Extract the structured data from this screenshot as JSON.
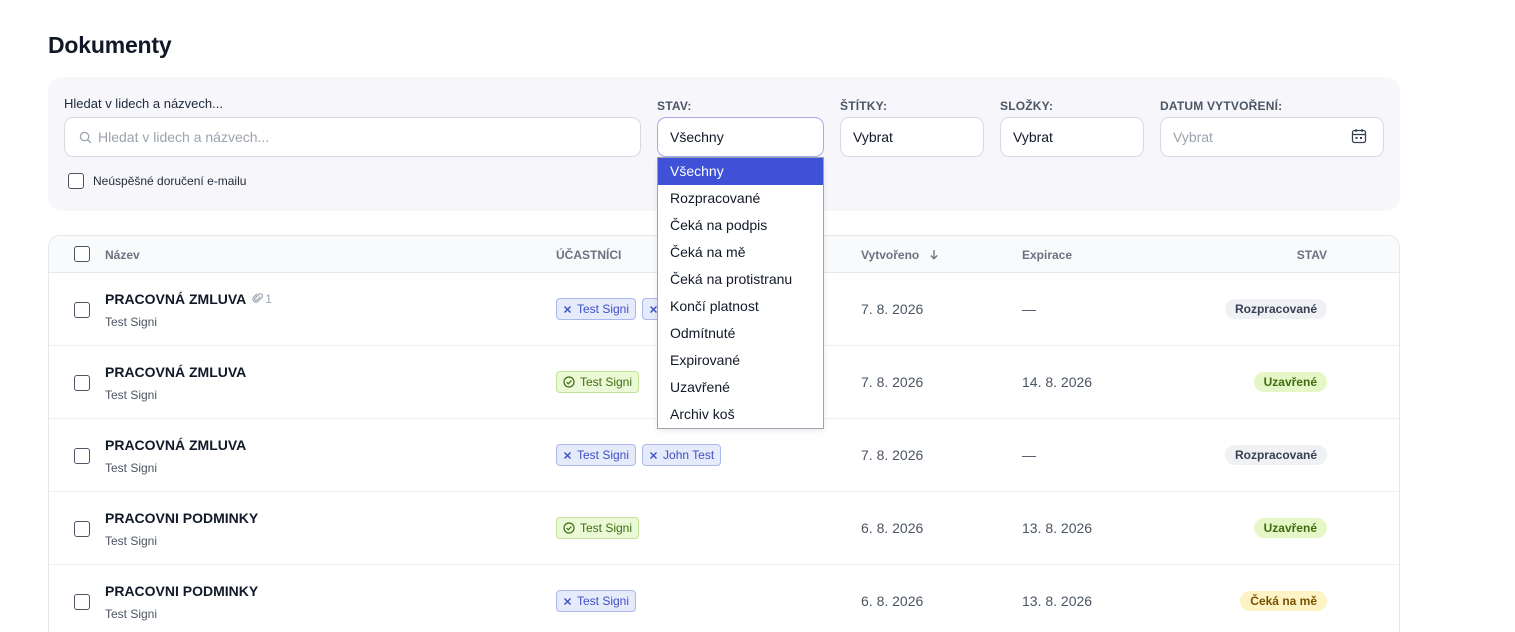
{
  "page": {
    "title": "Dokumenty"
  },
  "filters": {
    "search_label": "Hledat v lidech a názvech...",
    "search_placeholder": "Hledat v lidech a názvech...",
    "stav_label": "STAV:",
    "stav_value": "Všechny",
    "stitky_label": "ŠTÍTKY:",
    "stitky_value": "Vybrat",
    "slozky_label": "SLOŽKY:",
    "slozky_value": "Vybrat",
    "datum_label": "DATUM VYTVOŘENÍ:",
    "datum_placeholder": "Vybrat",
    "email_failed_label": "Neúspěšné doručení e-mailu"
  },
  "stav_dropdown": {
    "options": [
      "Všechny",
      "Rozpracované",
      "Čeká na podpis",
      "Čeká na mě",
      "Čeká na protistranu",
      "Končí platnost",
      "Odmítnuté",
      "Expirované",
      "Uzavřené",
      "Archiv koš"
    ],
    "selected": "Všechny"
  },
  "table": {
    "headers": {
      "name": "Název",
      "participants": "ÚČASTNÍCI",
      "created": "Vytvořeno",
      "expiry": "Expirace",
      "status": "STAV"
    },
    "rows": [
      {
        "title": "PRACOVNÁ ZMLUVA",
        "attachments": "1",
        "subtitle": "Test Signi",
        "chips": [
          {
            "label": "Test Signi",
            "state": "pending"
          },
          {
            "label": "",
            "state": "pending"
          }
        ],
        "created": "7. 8. 2026",
        "expiry": "—",
        "status": "Rozpracované",
        "status_kind": "draft"
      },
      {
        "title": "PRACOVNÁ ZMLUVA",
        "attachments": "",
        "subtitle": "Test Signi",
        "chips": [
          {
            "label": "Test Signi",
            "state": "signed"
          }
        ],
        "created": "7. 8. 2026",
        "expiry": "14. 8. 2026",
        "status": "Uzavřené",
        "status_kind": "closed"
      },
      {
        "title": "PRACOVNÁ ZMLUVA",
        "attachments": "",
        "subtitle": "Test Signi",
        "chips": [
          {
            "label": "Test Signi",
            "state": "pending"
          },
          {
            "label": "John Test",
            "state": "pending"
          }
        ],
        "created": "7. 8. 2026",
        "expiry": "—",
        "status": "Rozpracované",
        "status_kind": "draft"
      },
      {
        "title": "PRACOVNI PODMINKY",
        "attachments": "",
        "subtitle": "Test Signi",
        "chips": [
          {
            "label": "Test Signi",
            "state": "signed"
          }
        ],
        "created": "6. 8. 2026",
        "expiry": "13. 8. 2026",
        "status": "Uzavřené",
        "status_kind": "closed"
      },
      {
        "title": "PRACOVNI PODMINKY",
        "attachments": "",
        "subtitle": "Test Signi",
        "chips": [
          {
            "label": "Test Signi",
            "state": "pending"
          }
        ],
        "created": "6. 8. 2026",
        "expiry": "13. 8. 2026",
        "status": "Čeká na mě",
        "status_kind": "mine"
      }
    ]
  },
  "colors": {
    "accent": "#3f51d6",
    "panel_bg": "#f7f7fb",
    "pending_chip": "#e6ebfb",
    "signed_chip": "#ebf9d6"
  }
}
